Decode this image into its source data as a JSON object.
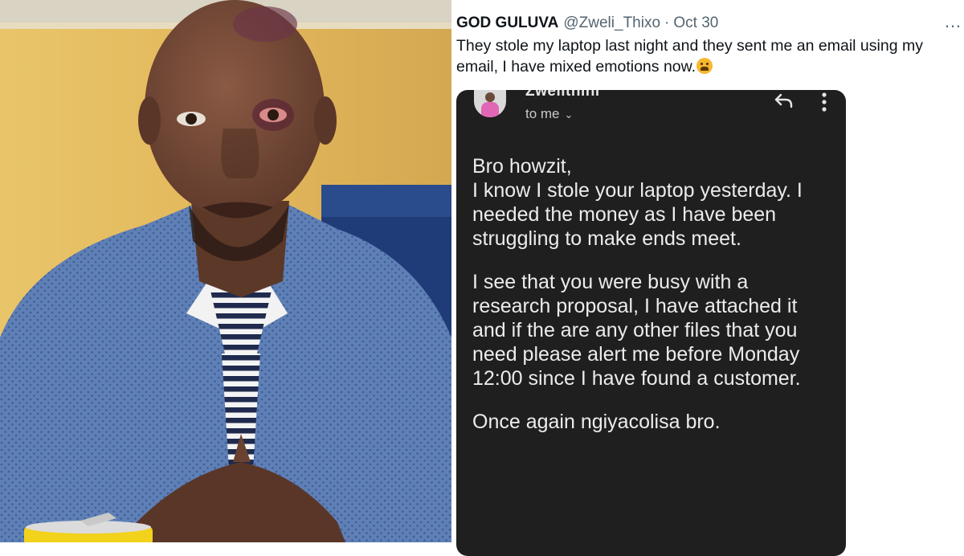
{
  "tweet": {
    "display_name": "GOD GULUVA",
    "handle": "@Zweli_Thixo",
    "separator": "·",
    "date": "Oct 30",
    "more_icon": "…",
    "text": "They stole my laptop last night and they sent me an email using my email, I have mixed emotions now.",
    "emoji_icon": "weary-face-emoji"
  },
  "email": {
    "sender": "Zwelithini",
    "to_label": "to me",
    "to_chevron": "⌄",
    "reply_icon": "reply-icon",
    "menu_icon": "more-vertical-icon",
    "paragraphs": [
      "Bro howzit,\nI know I stole your laptop yesterday. I needed the money as I have been struggling to make ends meet.",
      "I see that you were busy with a research proposal, I have attached it and if the are any other files that you need please alert me before Monday 12:00 since I have found a customer.",
      "Once again ngiyacolisa bro."
    ]
  },
  "photo": {
    "subject": "portrait-photo",
    "colors": {
      "wall": "#e0b75a",
      "shirt": "#5c7db3",
      "skin": "#6a4433",
      "can": "#f2d21b"
    }
  }
}
